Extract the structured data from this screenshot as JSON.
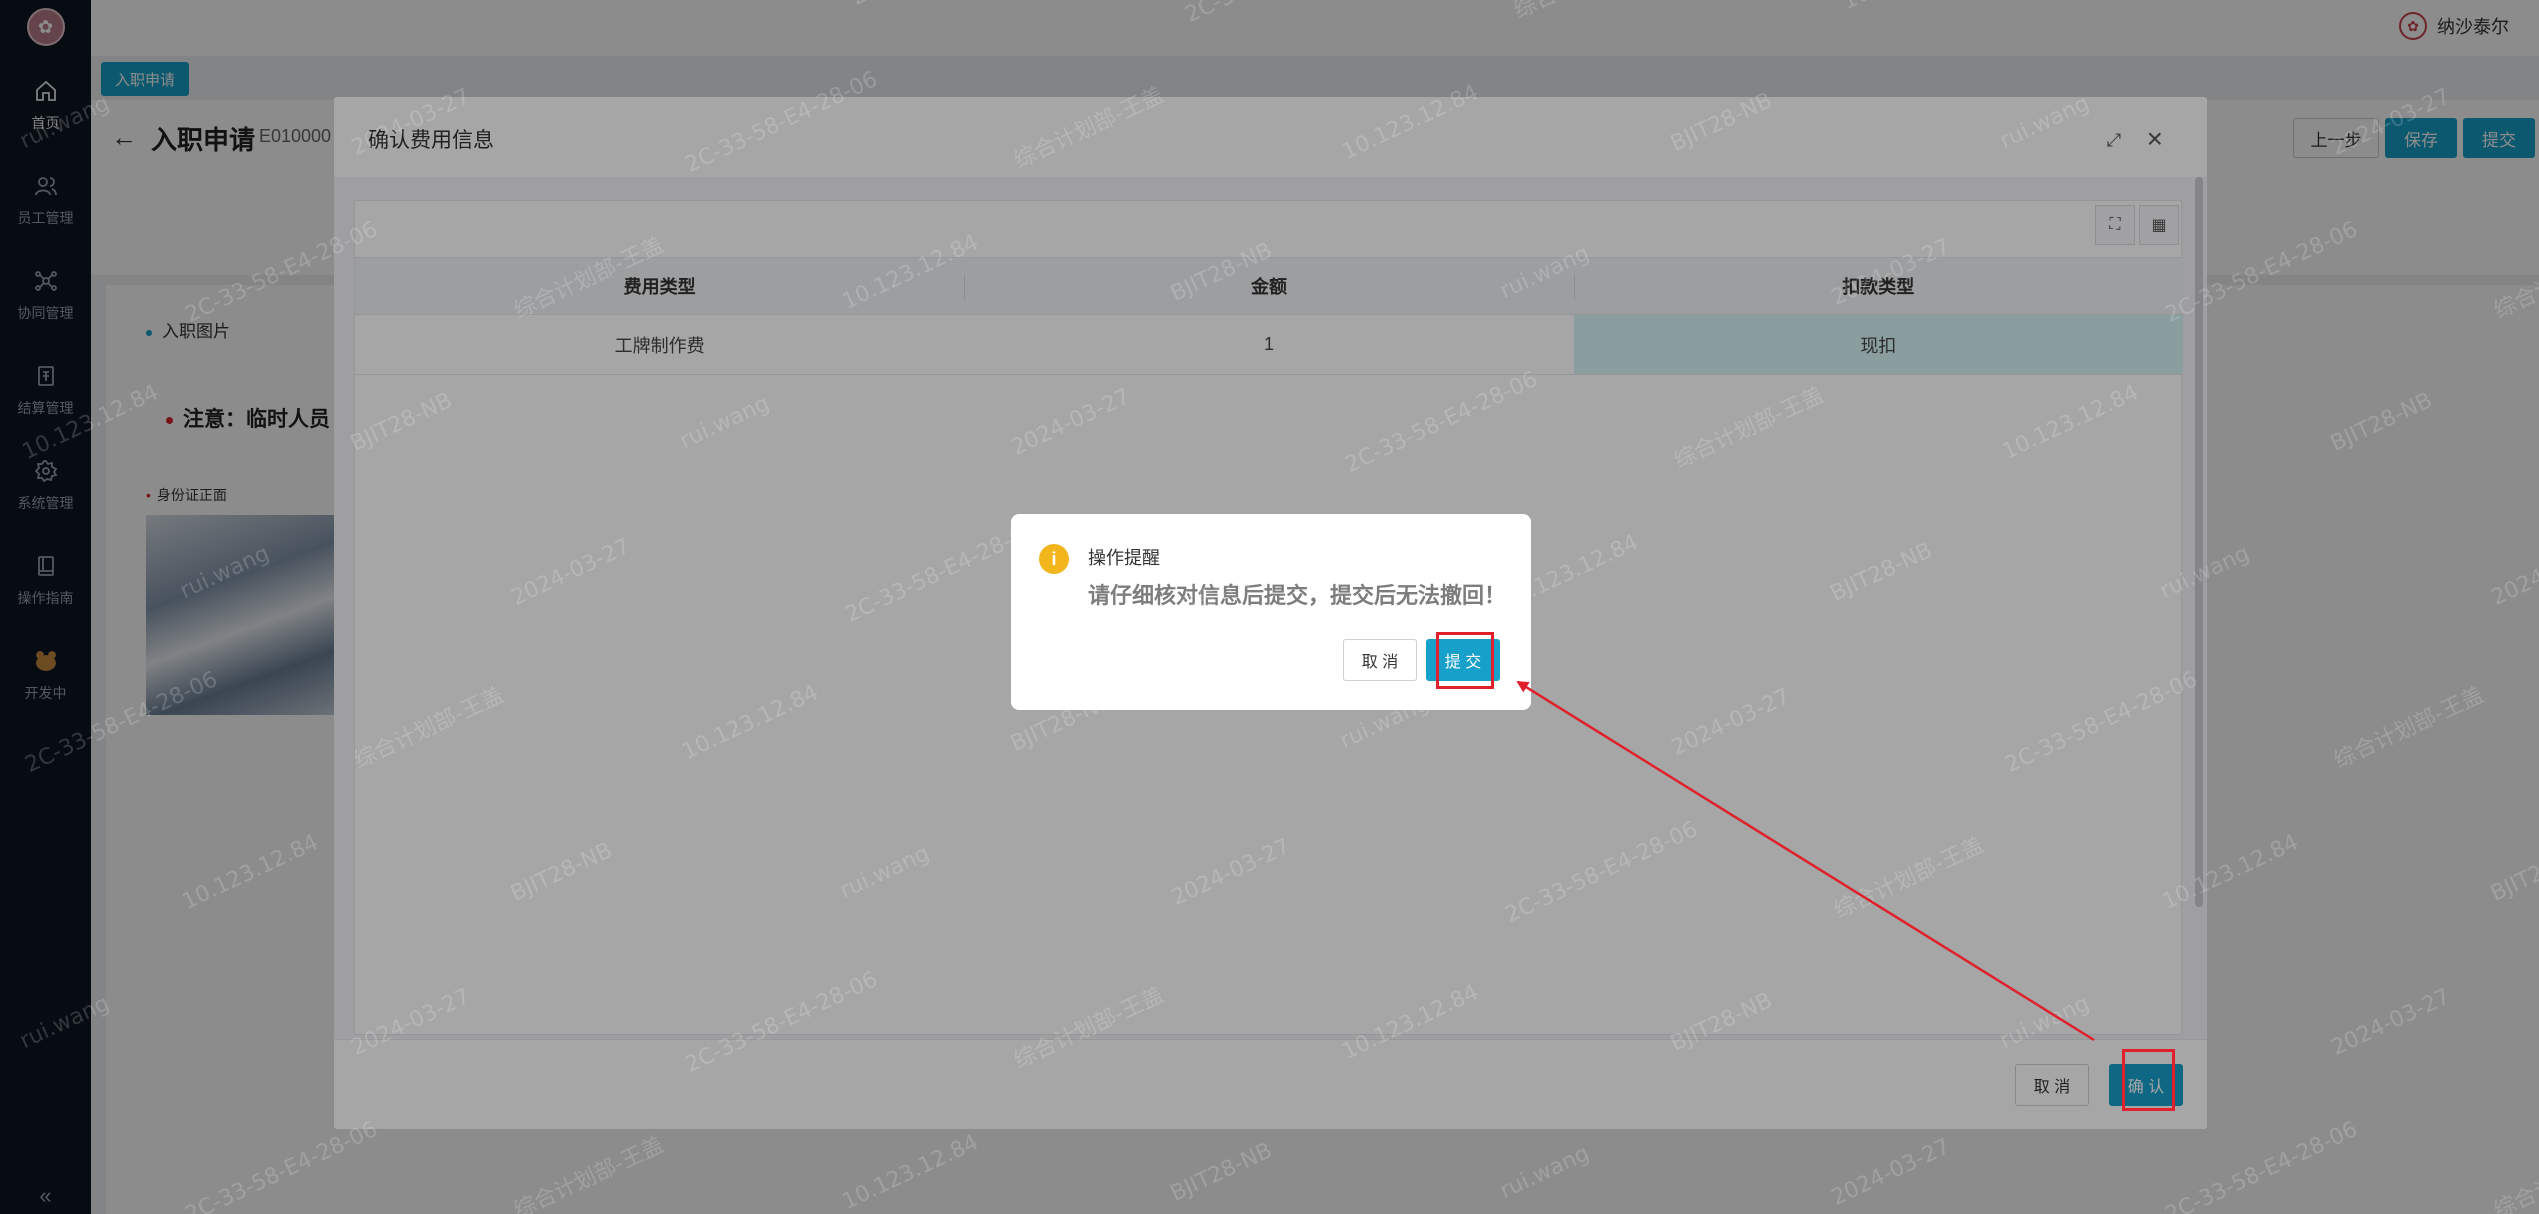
{
  "sidebar": {
    "items": [
      {
        "label": "首页",
        "icon": "home-icon"
      },
      {
        "label": "员工管理",
        "icon": "users-icon"
      },
      {
        "label": "协同管理",
        "icon": "network-icon"
      },
      {
        "label": "结算管理",
        "icon": "invoice-icon"
      },
      {
        "label": "系统管理",
        "icon": "gear-icon"
      },
      {
        "label": "操作指南",
        "icon": "book-icon"
      },
      {
        "label": "开发中",
        "icon": "bear-icon"
      }
    ],
    "collapse_glyph": "«"
  },
  "topbar": {
    "user_name": "纳沙泰尔"
  },
  "tabs": {
    "active_label": "入职申请"
  },
  "page": {
    "title": "入职申请",
    "code": "E010000",
    "prev_label": "上一步",
    "save_label": "保存",
    "submit_label": "提交",
    "section_label": "入职图片",
    "note": "注意：临时人员",
    "id_front_label": "身份证正面"
  },
  "modal": {
    "title": "确认费用信息",
    "columns": [
      "费用类型",
      "金额",
      "扣款类型"
    ],
    "rows": [
      {
        "fee_type": "工牌制作费",
        "amount": "1",
        "deduct_type": "现扣"
      }
    ],
    "cancel_label": "取 消",
    "confirm_label": "确 认"
  },
  "dialog": {
    "title": "操作提醒",
    "message": "请仔细核对信息后提交，提交后无法撤回！",
    "cancel_label": "取 消",
    "submit_label": "提 交"
  },
  "watermark": {
    "texts": [
      "10.123.12.84",
      "BJIT28-NB",
      "rui.wang",
      "2024-03-27",
      "2C-33-58-E4-28-06",
      "综合计划部-王盖"
    ]
  },
  "colors": {
    "primary": "#17a0c9",
    "sidebar_bg": "#0d1521",
    "highlight_cell": "#d4f2f5",
    "warning": "#f2b51c",
    "annotation": "#e0202b"
  }
}
